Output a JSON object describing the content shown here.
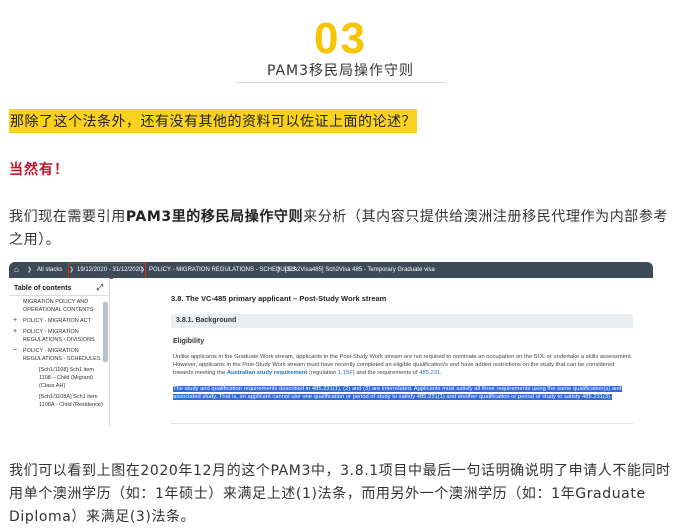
{
  "section": {
    "number": "03",
    "title": "PAM3移民局操作守则"
  },
  "question": "那除了这个法条外，还有没有其他的资料可以佐证上面的论述？",
  "answer": "当然有！",
  "para1": {
    "before": "我们现在需要引用",
    "bold": "PAM3里的移民局操作守则",
    "after": "来分析（其内容只提供给澳洲注册移民代理作为内部参考之用）。"
  },
  "screenshot": {
    "breadcrumb": {
      "home": "⌂",
      "items": [
        "All stacks",
        "19/12/2020 - 31/12/2020",
        "POLICY - MIGRATION REGULATIONS - SCHEDULES",
        "[Sch2Visa485] Sch2Visa 485 - Temporary Graduate visa"
      ]
    },
    "toc": {
      "title": "Table of contents",
      "items": [
        {
          "marker": "",
          "label": "MIGRATION POLICY AND OPERATIONAL CONTENTS"
        },
        {
          "marker": "+",
          "label": "POLICY - MIGRATION ACT"
        },
        {
          "marker": "+",
          "label": "POLICY - MIGRATION REGULATIONS - DIVISIONS"
        },
        {
          "marker": "−",
          "label": "POLICY - MIGRATION REGULATIONS - SCHEDULES"
        },
        {
          "marker": "",
          "label": "[Sch1/1108] Sch1 item 1108 – Child (Migrant) (Class AH)"
        },
        {
          "marker": "",
          "label": "[Sch1/1108A] Sch1 item 1108A - Child (Residence)"
        }
      ]
    },
    "content": {
      "heading": "3.8. The VC-485 primary applicant – Post-Study Work stream",
      "subheading": "3.8.1. Background",
      "eligibility": "Eligibility",
      "body_a": "Unlike applicants in the Graduate Work stream, applicants in the Post-Study Work stream are not required to nominate an occupation on the SOL or undertake a skills assessment. However, applicants in the Post-Study Work stream must have recently completed an eligible qualification/s and have added restrictions on the study that can be considered towards meeting the ",
      "body_link": "Australian study requirement",
      "body_b": " (regulation ",
      "body_reg": "1.15F",
      "body_c": ") and the requirements of ",
      "body_ref": "485.231",
      "body_d": ".",
      "highlight": "The study and qualification requirements described in 485.231(1), (2) and (3) are interrelated. Applicants must satisfy all three requirements using the same qualification(s) and associated study. That is, an applicant cannot use one qualification or period of study to satisfy 485.231(1) and another qualification or period of study to satisfy 485.231(3)."
    }
  },
  "para2": "我们可以看到上图在2020年12月的这个PAM3中，3.8.1项目中最后一句话明确说明了申请人不能同时用单个澳洲学历（如：1年硕士）来满足上述(1)法条，而用另外一个澳洲学历（如：1年Graduate Diploma）来满足(3)法条。"
}
